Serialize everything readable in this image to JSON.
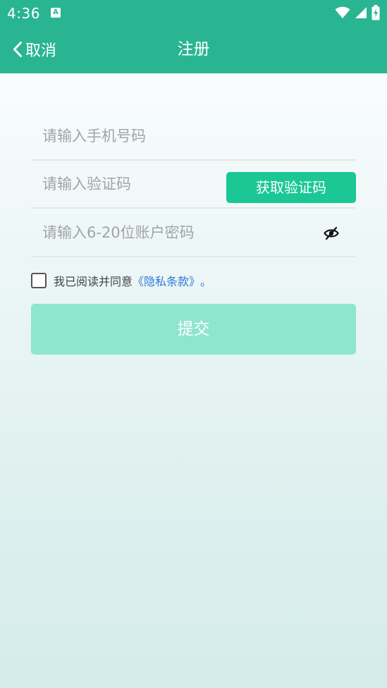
{
  "status_bar": {
    "time": "4:36",
    "notification_glyph": "A",
    "icons": [
      "wifi-icon",
      "cellular-signal-icon",
      "battery-charging-icon"
    ]
  },
  "app_bar": {
    "back_label": "取消",
    "title": "注册"
  },
  "form": {
    "phone": {
      "placeholder": "请输入手机号码",
      "value": ""
    },
    "verification": {
      "placeholder": "请输入验证码",
      "value": "",
      "button_label": "获取验证码"
    },
    "password": {
      "placeholder": "请输入6-20位账户密码",
      "value": "",
      "toggle_icon": "eye-off-icon"
    },
    "agreement": {
      "checked": false,
      "prefix": "我已阅读并同意",
      "link_label": "《隐私条款》",
      "suffix": "。"
    },
    "submit_label": "提交"
  },
  "colors": {
    "primary": "#29b592",
    "button_active": "#1bc795",
    "button_disabled": "#8ee5d0",
    "link": "#2f7ad8"
  }
}
